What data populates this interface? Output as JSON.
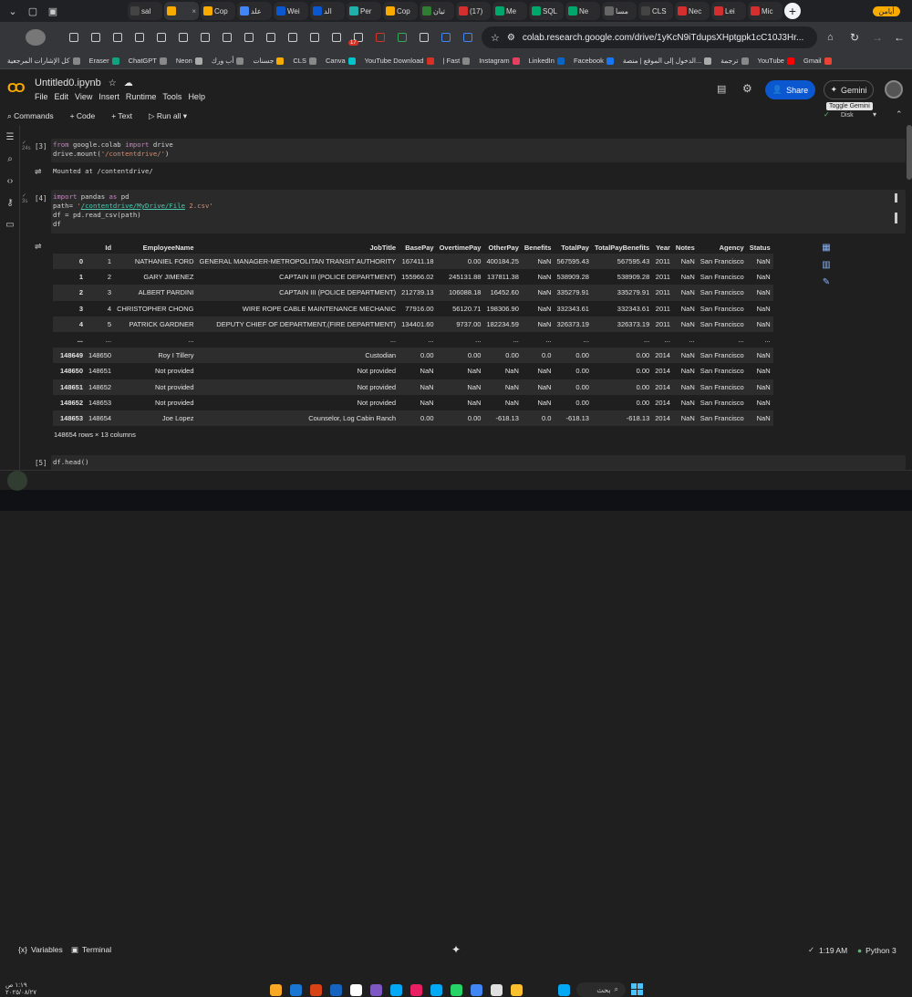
{
  "browser": {
    "tabs": [
      {
        "label": "sal",
        "color": "#444",
        "close": false
      },
      {
        "label": "",
        "color": "#f9ab00",
        "close": true
      },
      {
        "label": "Cop",
        "color": "#f9ab00"
      },
      {
        "label": "علد",
        "color": "#4285f4"
      },
      {
        "label": "Wei",
        "color": "#0b57d0"
      },
      {
        "label": "الد",
        "color": "#0b57d0"
      },
      {
        "label": "Per",
        "color": "#20b2aa"
      },
      {
        "label": "Cop",
        "color": "#f9ab00"
      },
      {
        "label": "تيان",
        "color": "#2e7d32"
      },
      {
        "label": "(17)",
        "color": "#d32f2f"
      },
      {
        "label": "Me",
        "color": "#00a86b"
      },
      {
        "label": "SQL",
        "color": "#00a86b"
      },
      {
        "label": "Ne",
        "color": "#00a86b"
      },
      {
        "label": "مسا",
        "color": "#666"
      },
      {
        "label": "CLS",
        "color": "#444"
      },
      {
        "label": "Nec",
        "color": "#d32f2f"
      },
      {
        "label": "Lei",
        "color": "#d32f2f"
      },
      {
        "label": "Mic",
        "color": "#d32f2f"
      }
    ],
    "profile_label": "أيامن",
    "url": "colab.research.google.com/drive/1yKcN9iTdupsXHptgpk1cC10J3Hr...",
    "bookmarks": [
      "كل الإشارات المرجعية",
      "Eraser",
      "ChatGPT",
      "Neon",
      "أب ورك",
      "جسنات",
      "CLS",
      "Canva",
      "YouTube Download",
      "| Fast",
      "Instagram",
      "LinkedIn",
      "Facebook",
      "الدخول إلى الموقع | منصة...",
      "ترجمة",
      "YouTube",
      "Gmail"
    ],
    "badge_count": "17"
  },
  "colab": {
    "title": "Untitled0.ipynb",
    "menus": [
      "File",
      "Edit",
      "View",
      "Insert",
      "Runtime",
      "Tools",
      "Help"
    ],
    "share_label": "Share",
    "gemini_label": "Gemini",
    "tooltip": "Toggle Gemini",
    "disk_label": "Disk",
    "commands_label": "Commands",
    "code_label": "+ Code",
    "text_label": "+ Text",
    "runall_label": "Run all"
  },
  "cells": {
    "c1": {
      "exec_count": "[3]",
      "time": "24s",
      "line1_kw1": "from",
      "line1_mid": " google.colab ",
      "line1_kw2": "import",
      "line1_end": " drive",
      "line2_start": "drive.mount(",
      "line2_str": "'/contentdrive/'",
      "line2_end": ")",
      "output": "Mounted at /contentdrive/"
    },
    "c2": {
      "exec_count": "[4]",
      "time": "3s",
      "line1_kw1": "import",
      "line1_mid": " pandas ",
      "line1_kw2": "as",
      "line1_end": " pd",
      "line2_start": "path= ",
      "line2_q1": "'",
      "line2_link": "/contentdrive/MyDrive/File",
      "line2_str": " 2.csv'",
      "line3": "df = pd.read_csv(path)",
      "line4": "df"
    },
    "c3": {
      "exec_count": "[5]",
      "code": "df.head()"
    }
  },
  "dataframe": {
    "columns": [
      "",
      "Id",
      "EmployeeName",
      "JobTitle",
      "BasePay",
      "OvertimePay",
      "OtherPay",
      "Benefits",
      "TotalPay",
      "TotalPayBenefits",
      "Year",
      "Notes",
      "Agency",
      "Status"
    ],
    "rows": [
      [
        "0",
        "1",
        "NATHANIEL FORD",
        "GENERAL MANAGER-METROPOLITAN TRANSIT AUTHORITY",
        "167411.18",
        "0.00",
        "400184.25",
        "NaN",
        "567595.43",
        "567595.43",
        "2011",
        "NaN",
        "San Francisco",
        "NaN"
      ],
      [
        "1",
        "2",
        "GARY JIMENEZ",
        "CAPTAIN III (POLICE DEPARTMENT)",
        "155966.02",
        "245131.88",
        "137811.38",
        "NaN",
        "538909.28",
        "538909.28",
        "2011",
        "NaN",
        "San Francisco",
        "NaN"
      ],
      [
        "2",
        "3",
        "ALBERT PARDINI",
        "CAPTAIN III (POLICE DEPARTMENT)",
        "212739.13",
        "106088.18",
        "16452.60",
        "NaN",
        "335279.91",
        "335279.91",
        "2011",
        "NaN",
        "San Francisco",
        "NaN"
      ],
      [
        "3",
        "4",
        "CHRISTOPHER CHONG",
        "WIRE ROPE CABLE MAINTENANCE MECHANIC",
        "77916.00",
        "56120.71",
        "198306.90",
        "NaN",
        "332343.61",
        "332343.61",
        "2011",
        "NaN",
        "San Francisco",
        "NaN"
      ],
      [
        "4",
        "5",
        "PATRICK GARDNER",
        "DEPUTY CHIEF OF DEPARTMENT,(FIRE DEPARTMENT)",
        "134401.60",
        "9737.00",
        "182234.59",
        "NaN",
        "326373.19",
        "326373.19",
        "2011",
        "NaN",
        "San Francisco",
        "NaN"
      ],
      [
        "...",
        "...",
        "...",
        "...",
        "...",
        "...",
        "...",
        "...",
        "...",
        "...",
        "...",
        "...",
        "...",
        "..."
      ],
      [
        "148649",
        "148650",
        "Roy I Tillery",
        "Custodian",
        "0.00",
        "0.00",
        "0.00",
        "0.0",
        "0.00",
        "0.00",
        "2014",
        "NaN",
        "San Francisco",
        "NaN"
      ],
      [
        "148650",
        "148651",
        "Not provided",
        "Not provided",
        "NaN",
        "NaN",
        "NaN",
        "NaN",
        "0.00",
        "0.00",
        "2014",
        "NaN",
        "San Francisco",
        "NaN"
      ],
      [
        "148651",
        "148652",
        "Not provided",
        "Not provided",
        "NaN",
        "NaN",
        "NaN",
        "NaN",
        "0.00",
        "0.00",
        "2014",
        "NaN",
        "San Francisco",
        "NaN"
      ],
      [
        "148652",
        "148653",
        "Not provided",
        "Not provided",
        "NaN",
        "NaN",
        "NaN",
        "NaN",
        "0.00",
        "0.00",
        "2014",
        "NaN",
        "San Francisco",
        "NaN"
      ],
      [
        "148653",
        "148654",
        "Joe Lopez",
        "Counselor, Log Cabin Ranch",
        "0.00",
        "0.00",
        "-618.13",
        "0.0",
        "-618.13",
        "-618.13",
        "2014",
        "NaN",
        "San Francisco",
        "NaN"
      ]
    ],
    "shape_text": "148654 rows × 13 columns"
  },
  "statusbar": {
    "variables_label": "Variables",
    "terminal_label": "Terminal",
    "time": "1:19 AM",
    "kernel": "Python 3"
  },
  "taskbar": {
    "search_label": "بحث",
    "clock_time": "١:١٩ ص",
    "clock_date": "٢٠٢٥/٠٨/٢٧",
    "app_colors": [
      "#f9a825",
      "#1976d2",
      "#d84315",
      "#1565c0",
      "#ffffff",
      "#7e57c2",
      "#03a9f4",
      "#e91e63",
      "#03a9f4",
      "#25d366",
      "#4285f4",
      "#e0e0e0",
      "#fbc02d",
      "#03a9f4"
    ]
  }
}
